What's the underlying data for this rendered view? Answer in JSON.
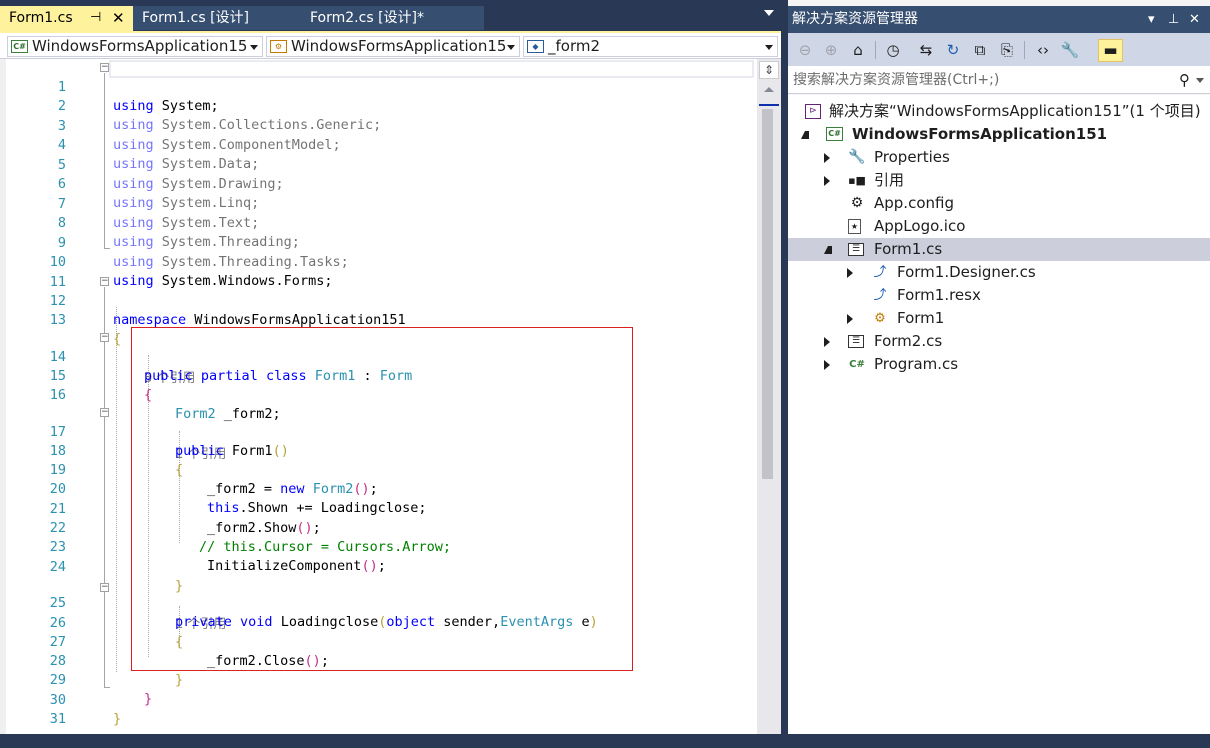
{
  "tabs": [
    {
      "label": "Form1.cs",
      "active": true,
      "pinned": true
    },
    {
      "label": "Form1.cs [设计]",
      "active": false
    },
    {
      "label": "Form2.cs [设计]*",
      "active": false
    }
  ],
  "nav": {
    "project": "WindowsFormsApplication15",
    "class": "WindowsFormsApplication15",
    "member": "_form2"
  },
  "code_lines": [
    {
      "n": "1",
      "text": "using System;"
    },
    {
      "n": "2",
      "text": "using System.Collections.Generic;"
    },
    {
      "n": "3",
      "text": "using System.ComponentModel;"
    },
    {
      "n": "4",
      "text": "using System.Data;"
    },
    {
      "n": "5",
      "text": "using System.Drawing;"
    },
    {
      "n": "6",
      "text": "using System.Linq;"
    },
    {
      "n": "7",
      "text": "using System.Text;"
    },
    {
      "n": "8",
      "text": "using System.Threading;"
    },
    {
      "n": "9",
      "text": "using System.Threading.Tasks;"
    },
    {
      "n": "10",
      "text": "using System.Windows.Forms;"
    },
    {
      "n": "11",
      "text": ""
    },
    {
      "n": "12",
      "text": "namespace WindowsFormsApplication151"
    },
    {
      "n": "13",
      "text": "{"
    },
    {
      "n": "14",
      "text": "public partial class Form1 : Form"
    },
    {
      "n": "15",
      "text": "{"
    },
    {
      "n": "16",
      "text": "Form2 _form2;"
    },
    {
      "n": "17",
      "text": "public Form1()"
    },
    {
      "n": "18",
      "text": "{"
    },
    {
      "n": "19",
      "text": "_form2 = new Form2();"
    },
    {
      "n": "20",
      "text": "this.Shown += Loadingclose;"
    },
    {
      "n": "21",
      "text": "_form2.Show();"
    },
    {
      "n": "22",
      "text": "// this.Cursor = Cursors.Arrow;"
    },
    {
      "n": "23",
      "text": "InitializeComponent();"
    },
    {
      "n": "24",
      "text": "}"
    },
    {
      "n": "25",
      "text": "private void Loadingclose(object sender,EventArgs e)"
    },
    {
      "n": "26",
      "text": "{"
    },
    {
      "n": "27",
      "text": "_form2.Close();"
    },
    {
      "n": "28",
      "text": "}"
    },
    {
      "n": "29",
      "text": "}"
    },
    {
      "n": "30",
      "text": "}"
    },
    {
      "n": "31",
      "text": ""
    }
  ],
  "codelens": {
    "class_refs": "3 个引用",
    "ctor_refs": "1 个引用",
    "method_refs": "1 个引用"
  },
  "solution_explorer": {
    "title": "解决方案资源管理器",
    "search_placeholder": "搜索解决方案资源管理器(Ctrl+;)",
    "tree": [
      {
        "label": "解决方案“WindowsFormsApplication151”(1 个项目)",
        "icon": "solution-icon"
      },
      {
        "label": "WindowsFormsApplication151",
        "icon": "csharp-project-icon",
        "bold": true
      },
      {
        "label": "Properties",
        "icon": "wrench-icon"
      },
      {
        "label": "引用",
        "icon": "references-icon"
      },
      {
        "label": "App.config",
        "icon": "config-icon"
      },
      {
        "label": "AppLogo.ico",
        "icon": "ico-file-icon"
      },
      {
        "label": "Form1.cs",
        "icon": "form-icon",
        "selected": true
      },
      {
        "label": "Form1.Designer.cs",
        "icon": "cs-file-icon"
      },
      {
        "label": "Form1.resx",
        "icon": "resx-file-icon"
      },
      {
        "label": "Form1",
        "icon": "class-icon"
      },
      {
        "label": "Form2.cs",
        "icon": "form-icon"
      },
      {
        "label": "Program.cs",
        "icon": "csharp-file-icon"
      }
    ]
  },
  "colors": {
    "accent_tab": "#fff29d",
    "chrome": "#293955",
    "keyword": "#0000ff",
    "type": "#2b91af",
    "comment": "#008000",
    "highlight_box": "#d9211f"
  }
}
